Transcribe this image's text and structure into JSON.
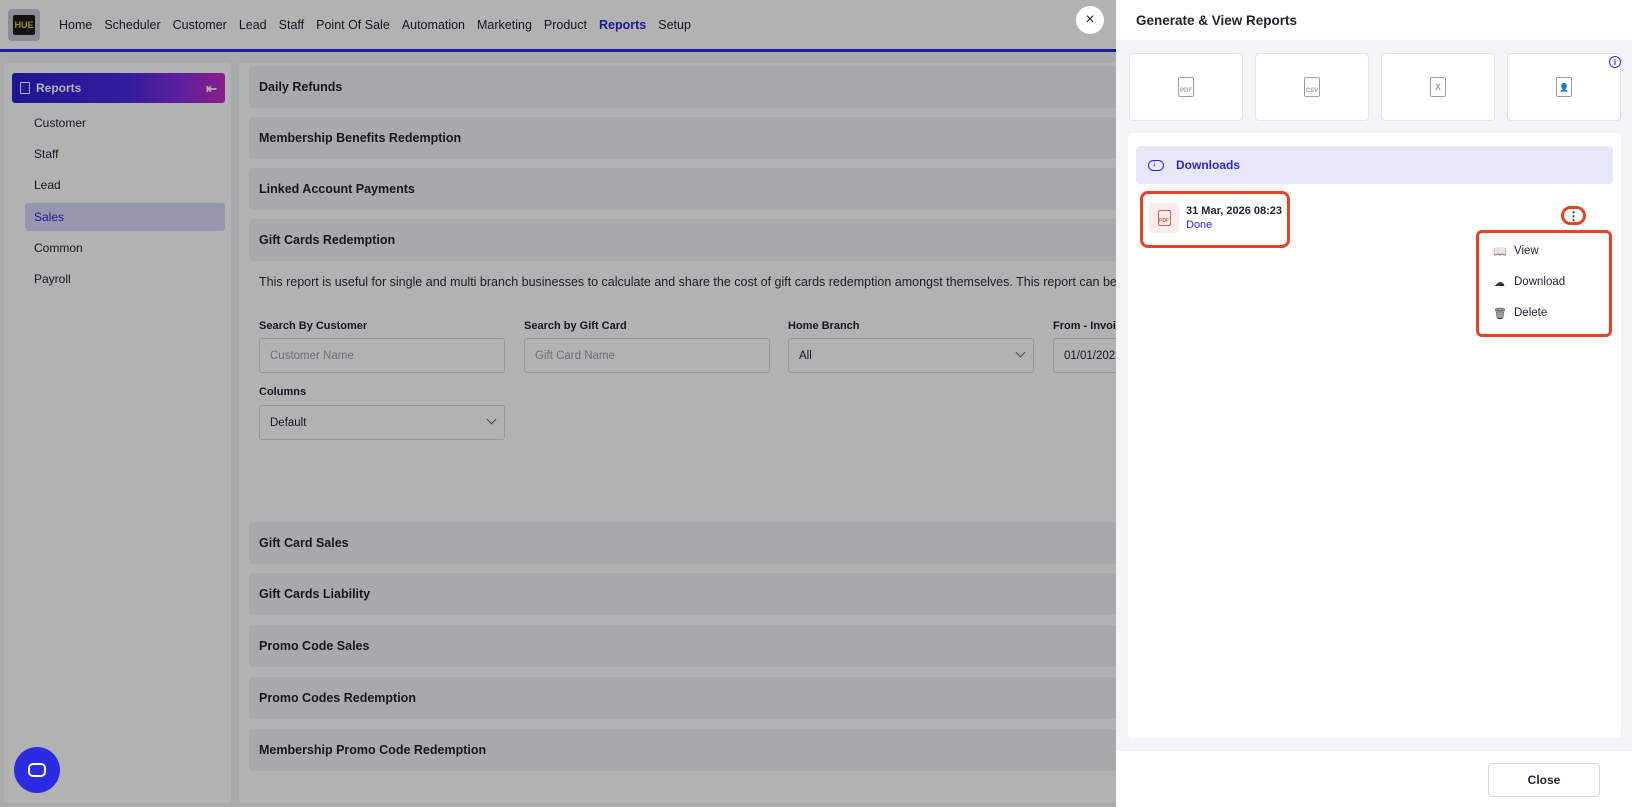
{
  "logo_text": "HUE",
  "nav": {
    "items": [
      {
        "label": "Home",
        "active": false
      },
      {
        "label": "Scheduler",
        "active": false
      },
      {
        "label": "Customer",
        "active": false
      },
      {
        "label": "Lead",
        "active": false
      },
      {
        "label": "Staff",
        "active": false
      },
      {
        "label": "Point Of Sale",
        "active": false
      },
      {
        "label": "Automation",
        "active": false
      },
      {
        "label": "Marketing",
        "active": false
      },
      {
        "label": "Product",
        "active": false
      },
      {
        "label": "Reports",
        "active": true
      },
      {
        "label": "Setup",
        "active": false
      }
    ]
  },
  "sidebar": {
    "title": "Reports",
    "items": [
      {
        "label": "Customer"
      },
      {
        "label": "Staff"
      },
      {
        "label": "Lead"
      },
      {
        "label": "Sales",
        "active": true
      },
      {
        "label": "Common"
      },
      {
        "label": "Payroll"
      }
    ]
  },
  "main": {
    "sections_top": [
      "Daily Refunds",
      "Membership Benefits Redemption",
      "Linked Account Payments",
      "Gift Cards Redemption"
    ],
    "description": "This report is useful for single and multi branch businesses to calculate and share the cost of gift cards redemption amongst themselves. This report can be c",
    "filters": {
      "search_customer_label": "Search By Customer",
      "search_customer_placeholder": "Customer Name",
      "search_giftcard_label": "Search by Gift Card",
      "search_giftcard_placeholder": "Gift Card Name",
      "home_branch_label": "Home Branch",
      "home_branch_value": "All",
      "from_label": "From - Invoic",
      "from_value": "01/01/202",
      "columns_label": "Columns",
      "columns_value": "Default"
    },
    "sections_bottom": [
      "Gift Card Sales",
      "Gift Cards Liability",
      "Promo Code Sales",
      "Promo Codes Redemption",
      "Membership Promo Code Redemption"
    ]
  },
  "overlay_close_icon": "×",
  "panel": {
    "title": "Generate & View Reports",
    "tiles": [
      {
        "icon": "pdf-file-icon",
        "glyph": "PDF"
      },
      {
        "icon": "csv-file-icon",
        "glyph": "CSV"
      },
      {
        "icon": "excel-file-icon",
        "glyph": "X"
      },
      {
        "icon": "contact-file-icon",
        "glyph": "👤"
      }
    ],
    "info_glyph": "i",
    "downloads_tab": "Downloads",
    "download": {
      "date": "31 Mar, 2026 08:23",
      "status": "Done",
      "badge": "PDF"
    },
    "menu": {
      "view": "View",
      "download": "Download",
      "delete": "Delete"
    },
    "close_label": "Close"
  },
  "colors": {
    "accent": "#2a27d6",
    "highlight": "#e0452a"
  }
}
